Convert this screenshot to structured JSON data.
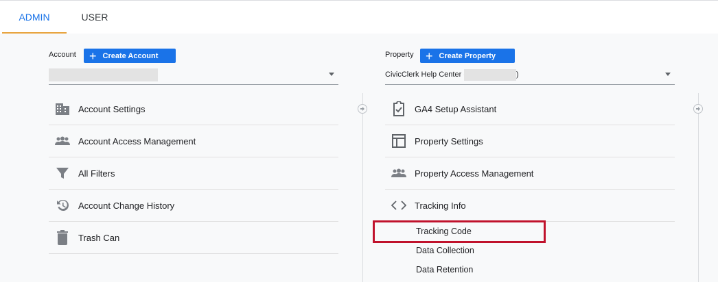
{
  "tabs": {
    "admin": "ADMIN",
    "user": "USER"
  },
  "account": {
    "label": "Account",
    "create_label": "Create Account",
    "items": [
      {
        "label": "Account Settings",
        "icon": "building-icon"
      },
      {
        "label": "Account Access Management",
        "icon": "people-icon"
      },
      {
        "label": "All Filters",
        "icon": "filter-icon"
      },
      {
        "label": "Account Change History",
        "icon": "history-icon"
      },
      {
        "label": "Trash Can",
        "icon": "trash-icon"
      }
    ]
  },
  "property": {
    "label": "Property",
    "create_label": "Create Property",
    "selected_prefix": "CivicClerk Help Center (",
    "selected_suffix": ")",
    "items": [
      {
        "label": "GA4 Setup Assistant",
        "icon": "clipboard-check-icon"
      },
      {
        "label": "Property Settings",
        "icon": "layout-icon"
      },
      {
        "label": "Property Access Management",
        "icon": "people-icon"
      },
      {
        "label": "Tracking Info",
        "icon": "code-icon"
      }
    ],
    "sub_items": [
      "Tracking Code",
      "Data Collection",
      "Data Retention"
    ]
  },
  "colors": {
    "accent": "#1a73e8",
    "tab_underline": "#e8a33d",
    "highlight": "#c0122c"
  }
}
